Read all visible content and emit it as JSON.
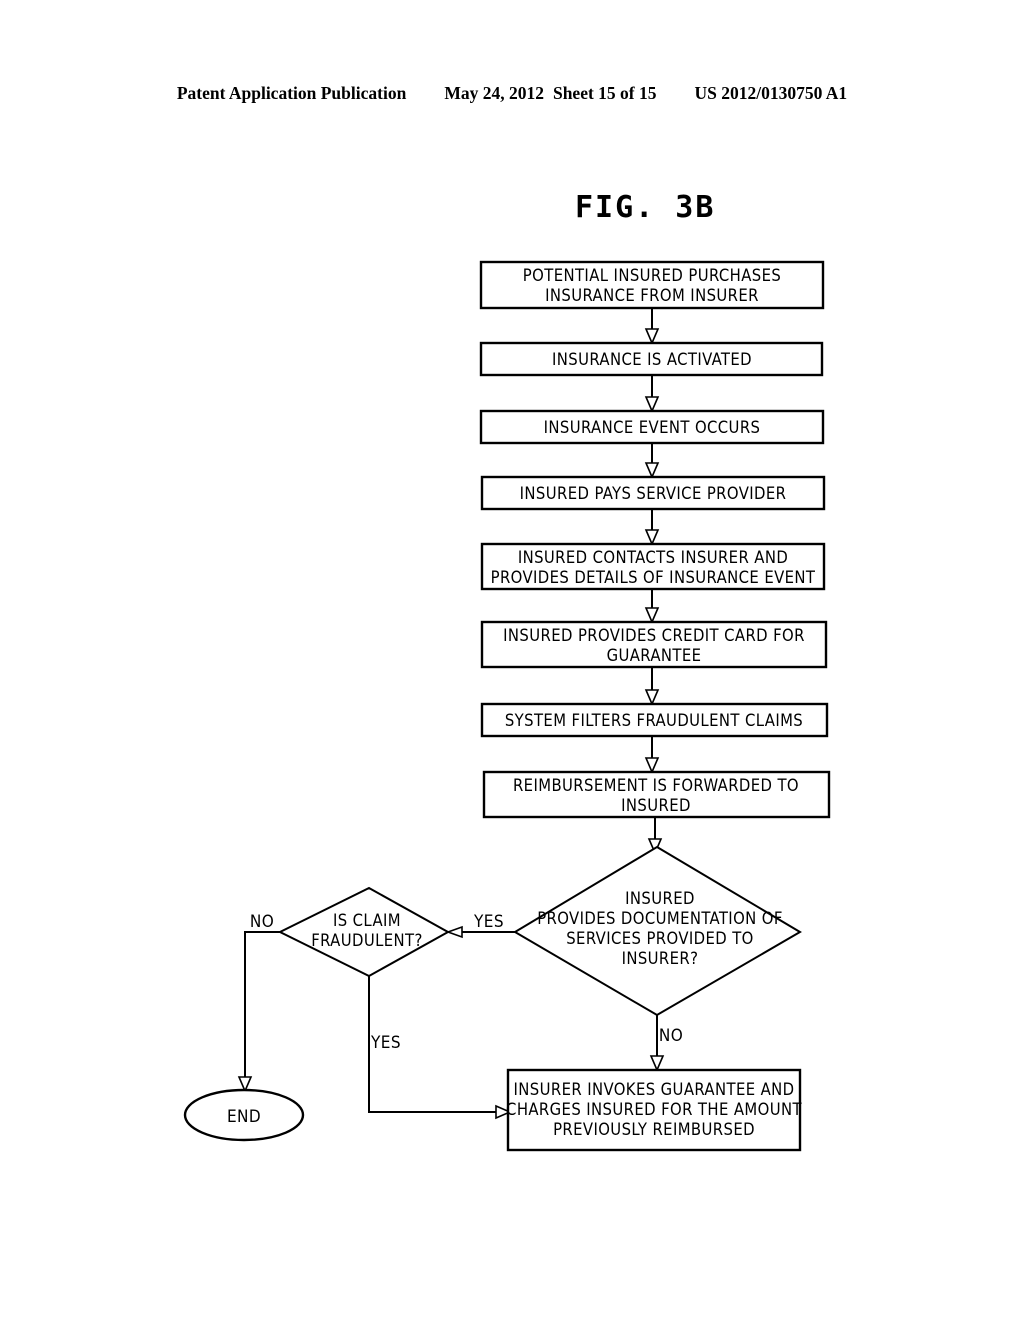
{
  "header": {
    "publication": "Patent Application Publication",
    "date": "May 24, 2012",
    "sheet": "Sheet 15 of 15",
    "number": "US 2012/0130750 A1"
  },
  "figure": {
    "title": "FIG. 3B"
  },
  "chart_data": {
    "type": "diagram",
    "diagram_type": "flowchart",
    "title": "FIG. 3B",
    "orientation": "top-to-bottom",
    "nodes": [
      {
        "id": "n1",
        "shape": "process",
        "lines": [
          "POTENTIAL INSURED PURCHASES",
          "INSURANCE FROM INSURER"
        ]
      },
      {
        "id": "n2",
        "shape": "process",
        "lines": [
          "INSURANCE IS ACTIVATED"
        ]
      },
      {
        "id": "n3",
        "shape": "process",
        "lines": [
          "INSURANCE EVENT OCCURS"
        ]
      },
      {
        "id": "n4",
        "shape": "process",
        "lines": [
          "INSURED PAYS SERVICE PROVIDER"
        ]
      },
      {
        "id": "n5",
        "shape": "process",
        "lines": [
          "INSURED CONTACTS INSURER AND",
          "PROVIDES DETAILS OF INSURANCE EVENT"
        ]
      },
      {
        "id": "n6",
        "shape": "process",
        "lines": [
          "INSURED PROVIDES CREDIT CARD FOR",
          "GUARANTEE"
        ]
      },
      {
        "id": "n7",
        "shape": "process",
        "lines": [
          "SYSTEM FILTERS FRAUDULENT CLAIMS"
        ]
      },
      {
        "id": "n8",
        "shape": "process",
        "lines": [
          "REIMBURSEMENT IS FORWARDED TO",
          "INSURED"
        ]
      },
      {
        "id": "d1",
        "shape": "decision",
        "lines": [
          "INSURED",
          "PROVIDES DOCUMENTATION OF",
          "SERVICES PROVIDED TO",
          "INSURER?"
        ]
      },
      {
        "id": "d2",
        "shape": "decision",
        "lines": [
          "IS CLAIM",
          "FRAUDULENT?"
        ]
      },
      {
        "id": "n9",
        "shape": "process",
        "lines": [
          "INSURER INVOKES GUARANTEE AND",
          "CHARGES INSURED FOR THE AMOUNT",
          "PREVIOUSLY REIMBURSED"
        ]
      },
      {
        "id": "end",
        "shape": "terminator",
        "lines": [
          "END"
        ]
      }
    ],
    "edges": [
      {
        "from": "n1",
        "to": "n2",
        "label": ""
      },
      {
        "from": "n2",
        "to": "n3",
        "label": ""
      },
      {
        "from": "n3",
        "to": "n4",
        "label": ""
      },
      {
        "from": "n4",
        "to": "n5",
        "label": ""
      },
      {
        "from": "n5",
        "to": "n6",
        "label": ""
      },
      {
        "from": "n6",
        "to": "n7",
        "label": ""
      },
      {
        "from": "n7",
        "to": "n8",
        "label": ""
      },
      {
        "from": "n8",
        "to": "d1",
        "label": ""
      },
      {
        "from": "d1",
        "to": "d2",
        "label": "YES"
      },
      {
        "from": "d1",
        "to": "n9",
        "label": "NO"
      },
      {
        "from": "d2",
        "to": "end",
        "label": "NO"
      },
      {
        "from": "d2",
        "to": "n9",
        "label": "YES"
      }
    ],
    "labels": {
      "yes_to_claim_check": "YES",
      "no_from_documentation": "NO",
      "no_from_fraudulent": "NO",
      "yes_from_fraudulent": "YES"
    }
  },
  "nodes": {
    "n1_line1": "POTENTIAL INSURED PURCHASES",
    "n1_line2": "INSURANCE FROM INSURER",
    "n2_line1": "INSURANCE IS ACTIVATED",
    "n3_line1": "INSURANCE EVENT OCCURS",
    "n4_line1": "INSURED PAYS SERVICE PROVIDER",
    "n5_line1": "INSURED CONTACTS INSURER AND",
    "n5_line2": "PROVIDES DETAILS OF INSURANCE EVENT",
    "n6_line1": "INSURED PROVIDES CREDIT CARD FOR",
    "n6_line2": "GUARANTEE",
    "n7_line1": "SYSTEM FILTERS FRAUDULENT CLAIMS",
    "n8_line1": "REIMBURSEMENT IS FORWARDED TO",
    "n8_line2": "INSURED",
    "d1_line1": "INSURED",
    "d1_line2": "PROVIDES DOCUMENTATION OF",
    "d1_line3": "SERVICES PROVIDED TO",
    "d1_line4": "INSURER?",
    "d2_line1": "IS CLAIM",
    "d2_line2": "FRAUDULENT?",
    "n9_line1": "INSURER INVOKES GUARANTEE AND",
    "n9_line2": "CHARGES INSURED FOR THE AMOUNT",
    "n9_line3": "PREVIOUSLY REIMBURSED",
    "end_label": "END"
  },
  "edge_labels": {
    "yes_right": "YES",
    "no_left": "NO",
    "no_down": "NO",
    "yes_down": "YES"
  },
  "colors": {
    "ink": "#000000",
    "paper": "#ffffff"
  }
}
